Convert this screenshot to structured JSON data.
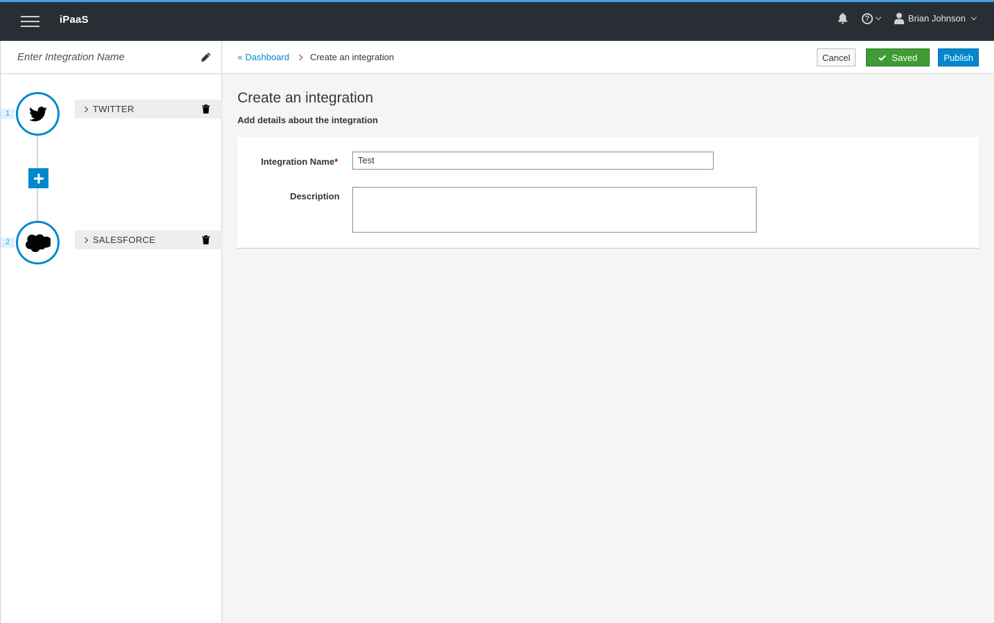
{
  "app": {
    "brand": "iPaaS"
  },
  "topnav": {
    "user_name": "Brian Johnson"
  },
  "sidebar": {
    "name_placeholder": "Enter Integration Name",
    "steps": [
      {
        "number": "1",
        "label": "TWITTER",
        "icon": "twitter-icon"
      },
      {
        "number": "2",
        "label": "SALESFORCE",
        "icon": "salesforce-icon"
      }
    ]
  },
  "breadcrumb": {
    "parent": "Dashboard",
    "current": "Create an integration"
  },
  "actions": {
    "cancel": "Cancel",
    "saved": "Saved",
    "publish": "Publish"
  },
  "page": {
    "title": "Create an integration",
    "subtitle": "Add details about the integration"
  },
  "form": {
    "name_label": "Integration Name",
    "name_required": "*",
    "name_value": "Test",
    "description_label": "Description",
    "description_value": ""
  },
  "colors": {
    "accent": "#0088ce",
    "success": "#3f9c35",
    "topbar": "#292e34"
  }
}
